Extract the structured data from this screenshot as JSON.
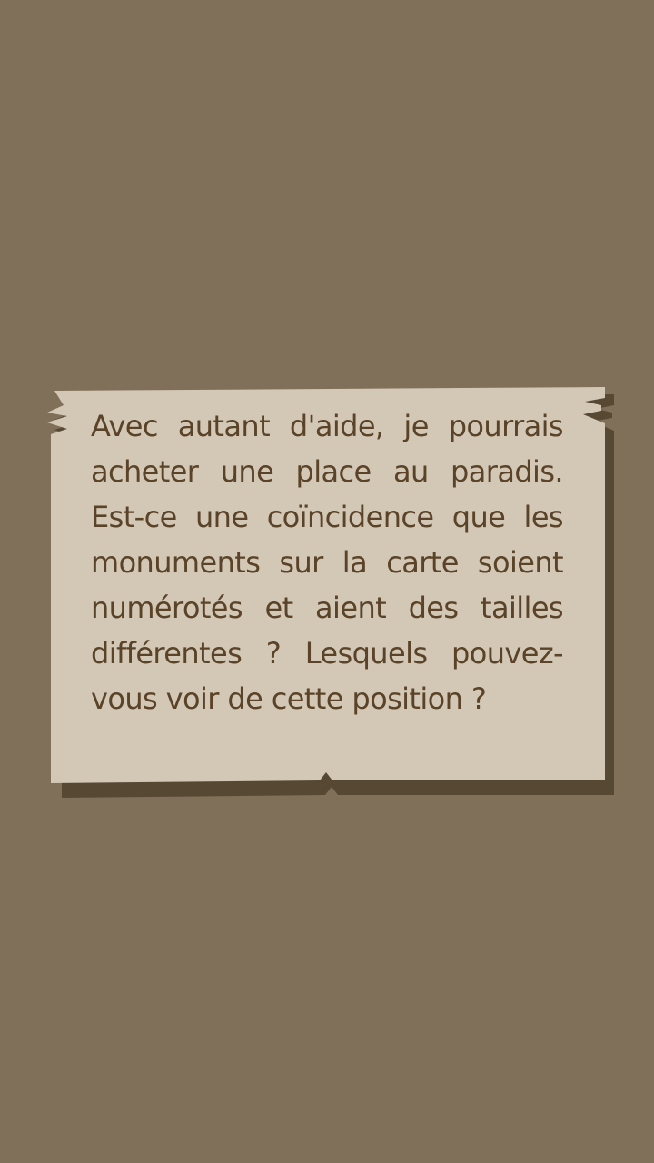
{
  "dialog": {
    "text": "Avec autant d'aide, je pourrais acheter une place au paradis. Est-ce une coïncidence que les monuments sur la carte soient numérotés et aient des tailles différentes ? Lesquels pouvez-vous voir de cette position ?"
  },
  "colors": {
    "background": "#807059",
    "paper": "#d3c8b6",
    "shadow": "#4a3b28",
    "text": "#5a4328"
  }
}
